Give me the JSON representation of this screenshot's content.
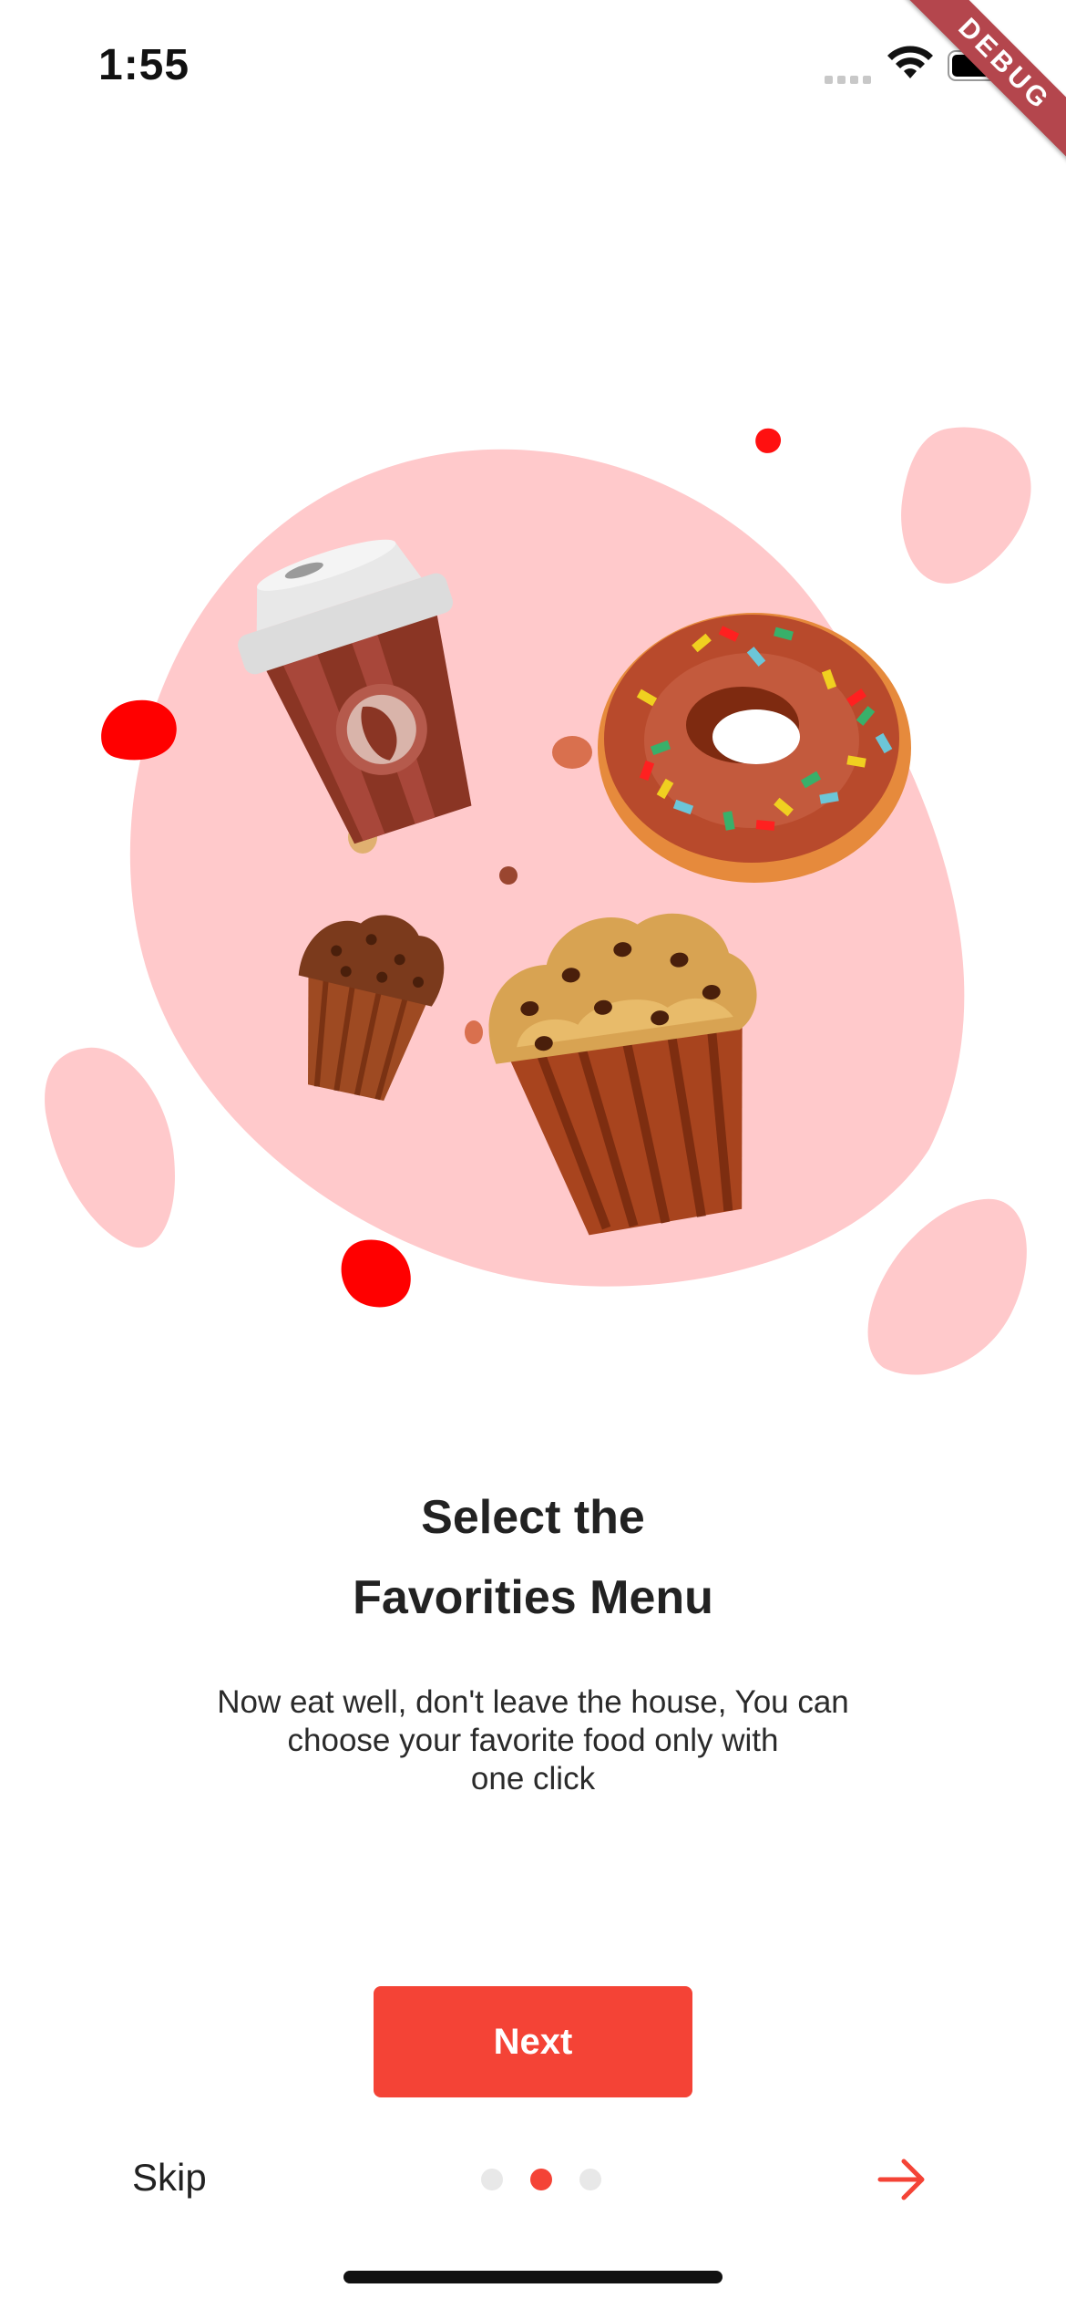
{
  "status_bar": {
    "time": "1:55"
  },
  "debug_banner": {
    "label": "DEBUG"
  },
  "onboarding": {
    "title_line1": "Select the",
    "title_line2": "Favorities Menu",
    "description_line1": "Now eat well, don't leave the house, You can",
    "description_line2": "choose your favorite food only with",
    "description_line3": "one click",
    "next_label": "Next",
    "skip_label": "Skip",
    "page_count": 3,
    "current_page": 2
  },
  "colors": {
    "accent": "#f44336",
    "blob_pink": "#ffc9cb",
    "blob_red": "#ff0000",
    "dot_inactive": "#e8e8e8"
  },
  "icons": {
    "signal": "signal-icon",
    "wifi": "wifi-icon",
    "battery": "battery-icon",
    "next_arrow": "arrow-right-icon"
  }
}
